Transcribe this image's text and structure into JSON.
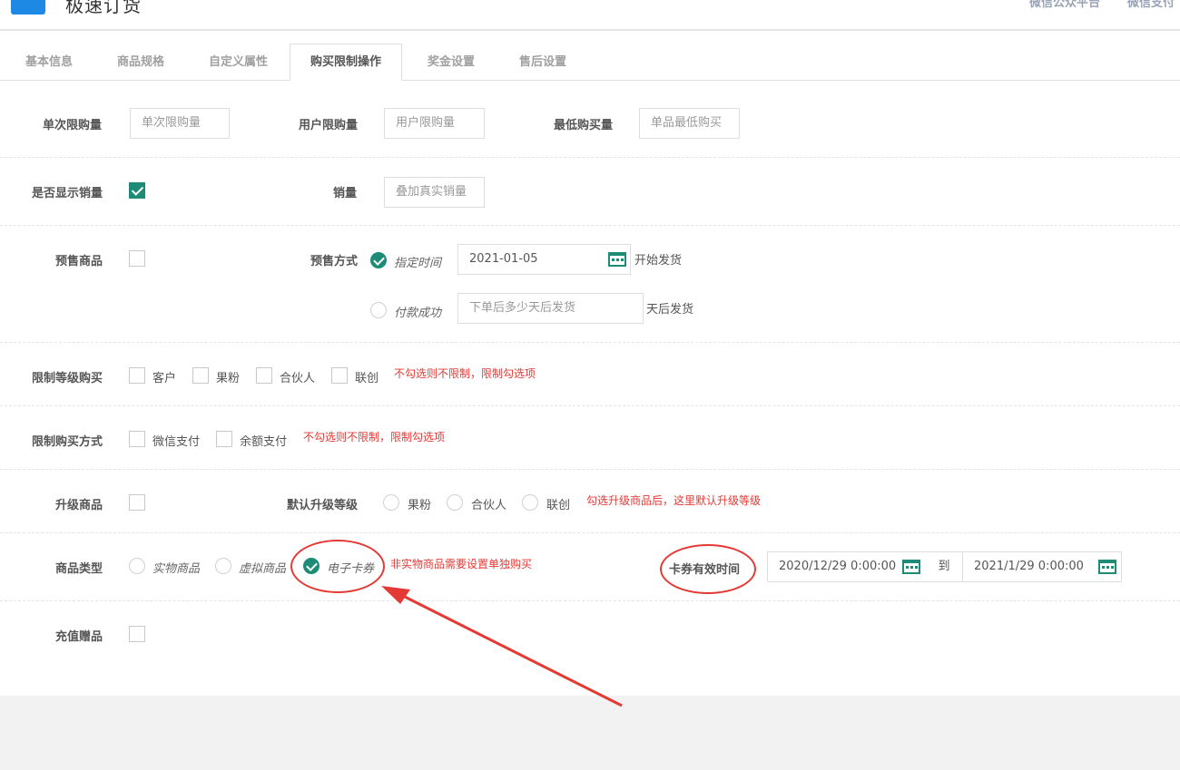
{
  "header": {
    "app_title": "极速订货",
    "links": [
      "微信公众平台",
      "微信支付"
    ]
  },
  "tabs": [
    {
      "label": "基本信息"
    },
    {
      "label": "商品规格"
    },
    {
      "label": "自定义属性"
    },
    {
      "label": "购买限制操作",
      "active": true
    },
    {
      "label": "奖金设置"
    },
    {
      "label": "售后设置"
    }
  ],
  "limits": {
    "single_label": "单次限购量",
    "single_placeholder": "单次限购量",
    "user_label": "用户限购量",
    "user_placeholder": "用户限购量",
    "min_label": "最低购买量",
    "min_placeholder": "单品最低购买"
  },
  "sales": {
    "show_label": "是否显示销量",
    "show_checked": true,
    "sales_label": "销量",
    "sales_placeholder": "叠加真实销量"
  },
  "presale": {
    "label": "预售商品",
    "checked": false,
    "mode_label": "预售方式",
    "option_time": "指定时间",
    "date_value": "2021-01-05",
    "time_suffix": "开始发货",
    "option_paid": "付款成功",
    "days_placeholder": "下单后多少天后发货",
    "paid_suffix": "天后发货"
  },
  "level_limit": {
    "label": "限制等级购买",
    "options": [
      "客户",
      "果粉",
      "合伙人",
      "联创"
    ],
    "note": "不勾选则不限制，限制勾选项"
  },
  "pay_limit": {
    "label": "限制购买方式",
    "options": [
      "微信支付",
      "余额支付"
    ],
    "note": "不勾选则不限制，限制勾选项"
  },
  "upgrade": {
    "label": "升级商品",
    "checked": false,
    "default_label": "默认升级等级",
    "options": [
      "果粉",
      "合伙人",
      "联创"
    ],
    "note": "勾选升级商品后，这里默认升级等级"
  },
  "goods_type": {
    "label": "商品类型",
    "options": [
      "实物商品",
      "虚拟商品",
      "电子卡券"
    ],
    "selected": "电子卡券",
    "note": "非实物商品需要设置单独购买",
    "validity_label": "卡券有效时间",
    "start": "2020/12/29 0:00:00",
    "to": "到",
    "end": "2021/1/29 0:00:00"
  },
  "gift": {
    "label": "充值赠品",
    "checked": false
  },
  "colors": {
    "accent": "#1c8c76",
    "annotation": "#e53935",
    "menu_button": "#1e88e5"
  }
}
